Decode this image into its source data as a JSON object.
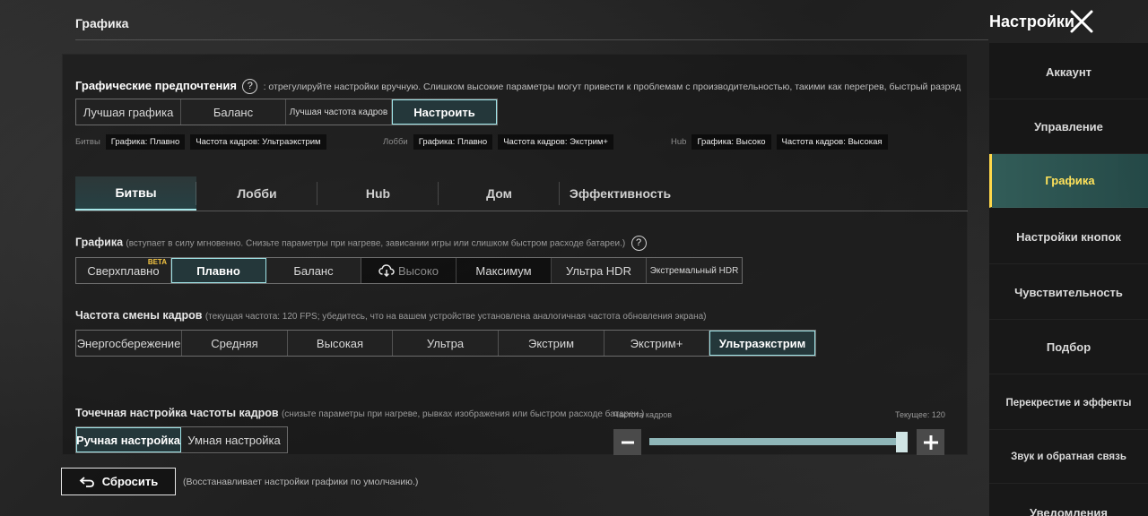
{
  "header": {
    "title": "Графика",
    "settings_title": "Настройки"
  },
  "preferences": {
    "heading": "Графические предпочтения",
    "help": "?",
    "description": ": отрегулируйте настройки вручную. Слишком высокие параметры могут привести к проблемам с производительностью, такими как перегрев, быстрый разряд батареи и",
    "presets": [
      {
        "label": "Лучшая графика",
        "selected": false
      },
      {
        "label": "Баланс",
        "selected": false
      },
      {
        "label": "Лучшая частота кадров",
        "selected": false
      },
      {
        "label": "Настроить",
        "selected": true
      }
    ]
  },
  "summary": {
    "battles": {
      "label": "Битвы",
      "graphics": "Графика: Плавно",
      "fps": "Частота кадров: Ультраэкстрим"
    },
    "lobby": {
      "label": "Лобби",
      "graphics": "Графика: Плавно",
      "fps": "Частота кадров: Экстрим+"
    },
    "hub": {
      "label": "Hub",
      "graphics": "Графика: Высоко",
      "fps": "Частота кадров: Высокая"
    }
  },
  "tabs": [
    {
      "label": "Битвы",
      "active": true
    },
    {
      "label": "Лобби",
      "active": false
    },
    {
      "label": "Hub",
      "active": false
    },
    {
      "label": "Дом",
      "active": false
    },
    {
      "label": "Эффективность",
      "active": false
    }
  ],
  "graphics": {
    "heading": "Графика",
    "description": "(вступает в силу мгновенно. Снизьте параметры при нагреве, зависании игры или слишком быстром расходе батареи.)",
    "help": "?",
    "beta_badge": "BETA",
    "options": [
      {
        "label": "Сверхплавно",
        "selected": false
      },
      {
        "label": "Плавно",
        "selected": true
      },
      {
        "label": "Баланс",
        "selected": false
      },
      {
        "label": "Высоко",
        "selected": false
      },
      {
        "label": "Максимум",
        "selected": false
      },
      {
        "label": "Ультра HDR",
        "selected": false
      },
      {
        "label": "Экстремальный HDR",
        "selected": false
      }
    ]
  },
  "frame_rate": {
    "heading": "Частота смены кадров",
    "description": "(текущая частота: 120 FPS; убедитесь, что на вашем устройстве установлена аналогичная частота обновления экрана)",
    "options": [
      {
        "label": "Энергосбережение",
        "selected": false
      },
      {
        "label": "Средняя",
        "selected": false
      },
      {
        "label": "Высокая",
        "selected": false
      },
      {
        "label": "Ультра",
        "selected": false
      },
      {
        "label": "Экстрим",
        "selected": false
      },
      {
        "label": "Экстрим+",
        "selected": false
      },
      {
        "label": "Ультраэкстрим",
        "selected": true
      }
    ]
  },
  "fine_tune": {
    "heading": "Точечная настройка частоты кадров",
    "description": "(снизьте параметры при нагреве, рывках изображения или быстром расходе батареи.)",
    "options": [
      {
        "label": "Ручная настройка",
        "selected": true
      },
      {
        "label": "Умная настройка",
        "selected": false
      }
    ],
    "slider_label": "Частота кадров",
    "current_label": "Текущее: 120",
    "slider_fraction": 0.99
  },
  "reset": {
    "label": "Сбросить",
    "note": "(Восстанавливает настройки графики по умолчанию.)"
  },
  "sidebar": {
    "items": [
      {
        "label": "Аккаунт",
        "active": false
      },
      {
        "label": "Управление",
        "active": false
      },
      {
        "label": "Графика",
        "active": true
      },
      {
        "label": "Настройки кнопок",
        "active": false
      },
      {
        "label": "Чувствительность",
        "active": false
      },
      {
        "label": "Подбор",
        "active": false
      },
      {
        "label": "Перекрестие и эффекты",
        "active": false
      },
      {
        "label": "Звук и обратная связь",
        "active": false
      },
      {
        "label": "Уведомления",
        "active": false
      }
    ]
  },
  "colors": {
    "accent": "#9fe3e6",
    "active_sidebar_text": "#ffe25a",
    "beta": "#f5c542"
  }
}
